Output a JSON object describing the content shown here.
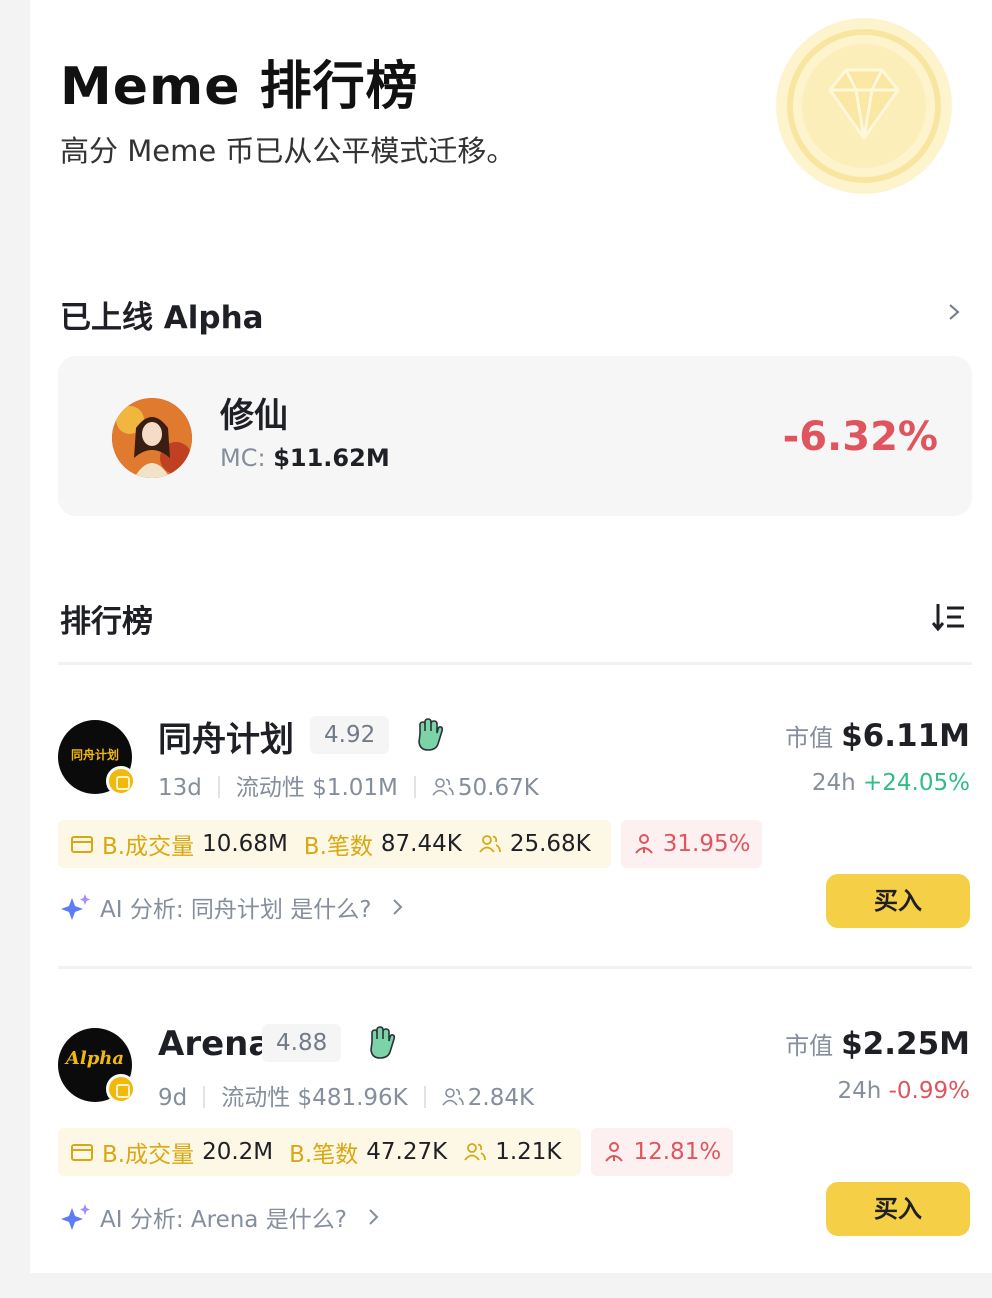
{
  "header": {
    "title": "Meme 排行榜",
    "subtitle": "高分 Meme 币已从公平模式迁移。"
  },
  "alpha_section": {
    "title": "已上线 Alpha",
    "card": {
      "name": "修仙",
      "mc_label": "MC:",
      "mc_value": "$11.62M",
      "change": "-6.32%"
    }
  },
  "ranking": {
    "title": "排行榜",
    "items": [
      {
        "avatar_text": "同舟计划",
        "name": "同舟计划",
        "score": "4.92",
        "age": "13d",
        "liquidity_label": "流动性",
        "liquidity_value": "$1.01M",
        "holders": "50.67K",
        "market_cap_label": "市值",
        "market_cap": "$6.11M",
        "change_label": "24h",
        "change": "+24.05%",
        "change_dir": "up",
        "b_volume_label": "B.成交量",
        "b_volume": "10.68M",
        "b_trades_label": "B.笔数",
        "b_trades": "87.44K",
        "b_users": "25.68K",
        "ratio": "31.95%",
        "ai_text": "AI 分析: 同舟计划 是什么?",
        "buy_label": "买入"
      },
      {
        "avatar_text": "Alpha",
        "name": "Arena",
        "score": "4.88",
        "age": "9d",
        "liquidity_label": "流动性",
        "liquidity_value": "$481.96K",
        "holders": "2.84K",
        "market_cap_label": "市值",
        "market_cap": "$2.25M",
        "change_label": "24h",
        "change": "-0.99%",
        "change_dir": "down",
        "b_volume_label": "B.成交量",
        "b_volume": "20.2M",
        "b_trades_label": "B.笔数",
        "b_trades": "47.27K",
        "b_users": "1.21K",
        "ratio": "12.81%",
        "ai_text": "AI 分析: Arena 是什么?",
        "buy_label": "买入"
      }
    ]
  },
  "colors": {
    "accent_yellow": "#f5cf45",
    "up_green": "#2ebd85",
    "down_red": "#e0555d",
    "muted_text": "#848e9c"
  },
  "icons": [
    "diamond-badge-icon",
    "chevron-right-icon",
    "sort-icon",
    "hand-wave-icon",
    "people-icon",
    "volume-icon",
    "ratio-person-icon",
    "ai-sparkle-icon"
  ]
}
